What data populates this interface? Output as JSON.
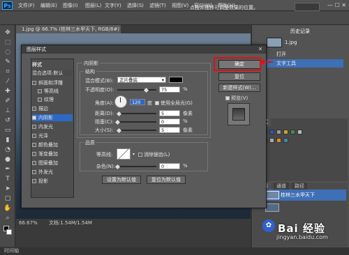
{
  "app": {
    "logo": "Ps",
    "menu": [
      "文件(F)",
      "编辑(E)",
      "图像(I)",
      "图层(L)",
      "文字(Y)",
      "选择(S)",
      "滤镜(T)",
      "视图(V)",
      "窗口(W)",
      "帮助(H)"
    ],
    "window_controls": "— ☐ ✕"
  },
  "options_bar": {
    "hint": "点按并拖移可调整效果的位置。",
    "dropdown": ""
  },
  "document": {
    "tab": "1.jpg @ 66.7% (桂林三水甲天下, RGB/8#) * ×",
    "status_zoom": "66.67%",
    "status_doc": "文档:1.54M/1.54M"
  },
  "bottom_bar": "时间轴",
  "panels": {
    "top_tabs": [
      "历史记录"
    ],
    "history_file": "1.jpg",
    "history_items": [
      "打开",
      "文字工具"
    ],
    "mid_tabs": [
      "样式"
    ],
    "layers_tabs": [
      "图层",
      "通道",
      "路径"
    ],
    "layers": [
      "桂林三水甲天下",
      ""
    ]
  },
  "dialog": {
    "title": "图层样式",
    "close": "✕",
    "styles_header": "样式",
    "blend_options": "混合选项:默认",
    "styles_list": [
      {
        "label": "斜面和浮雕",
        "checked": false,
        "indent": false
      },
      {
        "label": "等高线",
        "checked": false,
        "indent": true
      },
      {
        "label": "纹理",
        "checked": false,
        "indent": true
      },
      {
        "label": "描边",
        "checked": false,
        "indent": false
      },
      {
        "label": "内阴影",
        "checked": true,
        "indent": false,
        "selected": true
      },
      {
        "label": "内发光",
        "checked": false,
        "indent": false
      },
      {
        "label": "光泽",
        "checked": false,
        "indent": false
      },
      {
        "label": "颜色叠加",
        "checked": false,
        "indent": false
      },
      {
        "label": "渐变叠加",
        "checked": false,
        "indent": false
      },
      {
        "label": "图案叠加",
        "checked": false,
        "indent": false
      },
      {
        "label": "外发光",
        "checked": false,
        "indent": false
      },
      {
        "label": "投影",
        "checked": false,
        "indent": false
      }
    ],
    "section_title": "内阴影",
    "structure_title": "结构",
    "blend_mode_label": "混合模式(B):",
    "blend_mode_value": "正片叠底",
    "opacity_label": "不透明度(O):",
    "opacity_value": "75",
    "percent": "%",
    "angle_label": "角度(A):",
    "angle_value": "120",
    "angle_unit": "度",
    "global_light_label": "使用全局光(G)",
    "distance_label": "距离(D):",
    "distance_value": "5",
    "choke_label": "阻塞(C):",
    "choke_value": "0",
    "size_label": "大小(S):",
    "size_value": "5",
    "px": "像素",
    "quality_title": "品质",
    "contour_label": "等高线:",
    "antialias_label": "消除锯齿(L)",
    "noise_label": "杂色(N):",
    "noise_value": "0",
    "set_default": "设置为默认值",
    "reset_default": "复位为默认值",
    "ok": "确定",
    "reset": "复位",
    "new_style": "新建样式(W)...",
    "preview_label": "预览(V)"
  },
  "watermark": {
    "brand": "Bai 经验",
    "url": "jingyan.baidu.com"
  }
}
